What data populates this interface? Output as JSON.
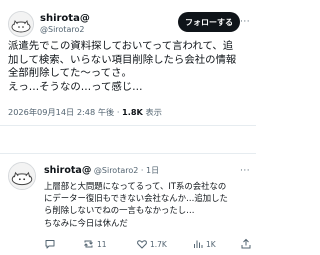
{
  "post": {
    "display_name": "shirota@",
    "handle": "@Sirotaro2",
    "follow_label": "フォローする",
    "more": "···",
    "lines": [
      "派遣先でこの資料探しておいてって言われて、追",
      "加して検索、いらない項目削除したら会社の情報",
      "全部削除してた〜ってさ。",
      "えっ…そうなの…って感じ…"
    ],
    "timestamp": "2026年09月14日 2:48 午後",
    "separator": "·",
    "views_count": "1.8K",
    "views_label": "表示"
  },
  "reply": {
    "display_name": "shirota@",
    "handle": "@Sirotaro2",
    "separator": "·",
    "time_ago": "1日",
    "more": "···",
    "lines": [
      "上層部と大問題になってるって、IT系の会社なの",
      "にデーター復旧もできない会社なんか…追加した",
      "ら削除しないでねの一言もなかったし…",
      "ちなみに今日は休んだ"
    ],
    "actions": {
      "reply_count": "",
      "retweet_count": "11",
      "like_count": "1.7K",
      "views_count": "1K"
    }
  },
  "colors": {
    "text": "#0f1419",
    "secondary": "#536471",
    "button_bg": "#0f1419",
    "divider": "#e6ecf0"
  }
}
